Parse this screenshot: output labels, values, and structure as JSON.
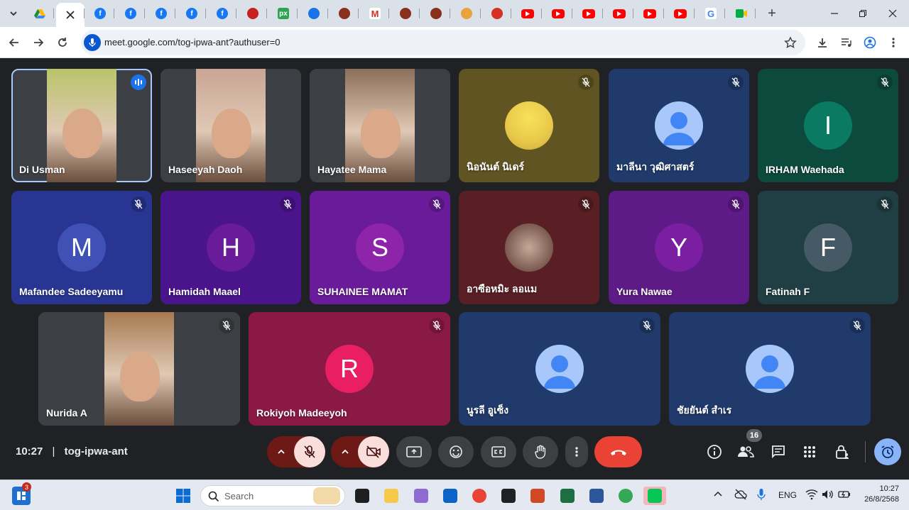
{
  "browser": {
    "url": "meet.google.com/tog-ipwa-ant?authuser=0",
    "tabs": [
      {
        "icon": "drive-icon",
        "color": "#1e8e3e"
      },
      {
        "icon": "close-icon",
        "color": "#202124",
        "active": true
      },
      {
        "icon": "facebook-icon",
        "color": "#1877f2"
      },
      {
        "icon": "facebook-icon",
        "color": "#1877f2"
      },
      {
        "icon": "facebook-icon",
        "color": "#1877f2"
      },
      {
        "icon": "facebook-icon",
        "color": "#1877f2"
      },
      {
        "icon": "facebook-icon",
        "color": "#1877f2"
      },
      {
        "icon": "app-icon",
        "color": "#c5221f"
      },
      {
        "icon": "px-icon",
        "color": "#2da44e"
      },
      {
        "icon": "app-icon",
        "color": "#1a73e8"
      },
      {
        "icon": "app-icon",
        "color": "#8a2f1c"
      },
      {
        "icon": "gmail-icon",
        "color": "#d93025"
      },
      {
        "icon": "app-icon",
        "color": "#8a2f1c"
      },
      {
        "icon": "app-icon",
        "color": "#8a2f1c"
      },
      {
        "icon": "app-icon",
        "color": "#e8a33d"
      },
      {
        "icon": "app-icon",
        "color": "#d93025"
      },
      {
        "icon": "youtube-icon",
        "color": "#ff0000"
      },
      {
        "icon": "youtube-icon",
        "color": "#ff0000"
      },
      {
        "icon": "youtube-icon",
        "color": "#ff0000"
      },
      {
        "icon": "youtube-icon",
        "color": "#ff0000"
      },
      {
        "icon": "youtube-icon",
        "color": "#ff0000"
      },
      {
        "icon": "youtube-icon",
        "color": "#ff0000"
      },
      {
        "icon": "google-icon",
        "color": "#4285f4"
      },
      {
        "icon": "meet-icon",
        "color": "#00ac47"
      }
    ],
    "new_tab_label": "+"
  },
  "meeting": {
    "time": "10:27",
    "separator": "|",
    "code": "tog-ipwa-ant",
    "participant_count": "16",
    "participants": [
      {
        "name": "Di Usman",
        "type": "video",
        "bg": "#3c3f43",
        "speaking": true
      },
      {
        "name": "Haseeyah Daoh",
        "type": "video",
        "bg": "#3c3f43"
      },
      {
        "name": "Hayatee Mama",
        "type": "video",
        "bg": "#3c3f43"
      },
      {
        "name": "นิอนันต์ นิเดร์",
        "type": "photo",
        "bg": "#5f5422",
        "muted": true
      },
      {
        "name": "มาลีนา วุฒิศาสตร์",
        "type": "default",
        "bg": "#1f3a6b",
        "muted": true
      },
      {
        "name": "IRHAM Waehada",
        "type": "letter",
        "letter": "I",
        "avatar_color": "#0b7a63",
        "bg": "#0d4a3e",
        "muted": true
      },
      {
        "name": "Mafandee Sadeeyamu",
        "type": "letter",
        "letter": "M",
        "avatar_color": "#3f51b5",
        "bg": "#283593",
        "muted": true
      },
      {
        "name": "Hamidah Maael",
        "type": "letter",
        "letter": "H",
        "avatar_color": "#6a1b9a",
        "bg": "#4a148c",
        "muted": true
      },
      {
        "name": "SUHAINEE MAMAT",
        "type": "letter",
        "letter": "S",
        "avatar_color": "#8e24aa",
        "bg": "#6a1b9a",
        "muted": true
      },
      {
        "name": "อาซือหมิะ ลอแม",
        "type": "photo",
        "bg": "#5a1f24",
        "muted": true
      },
      {
        "name": "Yura Nawae",
        "type": "letter",
        "letter": "Y",
        "avatar_color": "#7b1fa2",
        "bg": "#5e1a86",
        "muted": true
      },
      {
        "name": "Fatinah F",
        "type": "letter",
        "letter": "F",
        "avatar_color": "#455a64",
        "bg": "#1f3f44",
        "muted": true
      },
      {
        "name": "Nurida A",
        "type": "video",
        "bg": "#3c3f43",
        "muted": true
      },
      {
        "name": "Rokiyoh Madeeyoh",
        "type": "letter",
        "letter": "R",
        "avatar_color": "#e91e63",
        "bg": "#8a1a45",
        "muted": true
      },
      {
        "name": "นูรลี อูเซ็ง",
        "type": "default",
        "bg": "#1f3a6b",
        "muted": true
      },
      {
        "name": "ชัยยันต์ สำเร",
        "type": "default",
        "bg": "#1f3a6b",
        "muted": true
      }
    ]
  },
  "taskbar": {
    "search_placeholder": "Search",
    "widget_badge": "3",
    "lang": "ENG",
    "clock_time": "10:27",
    "clock_date": "26/8/2568"
  },
  "colors": {
    "end_call": "#ea4335",
    "muted_btn": "#f9dedc",
    "dark_red": "#6d1a16",
    "control_bg": "#3c4043"
  }
}
